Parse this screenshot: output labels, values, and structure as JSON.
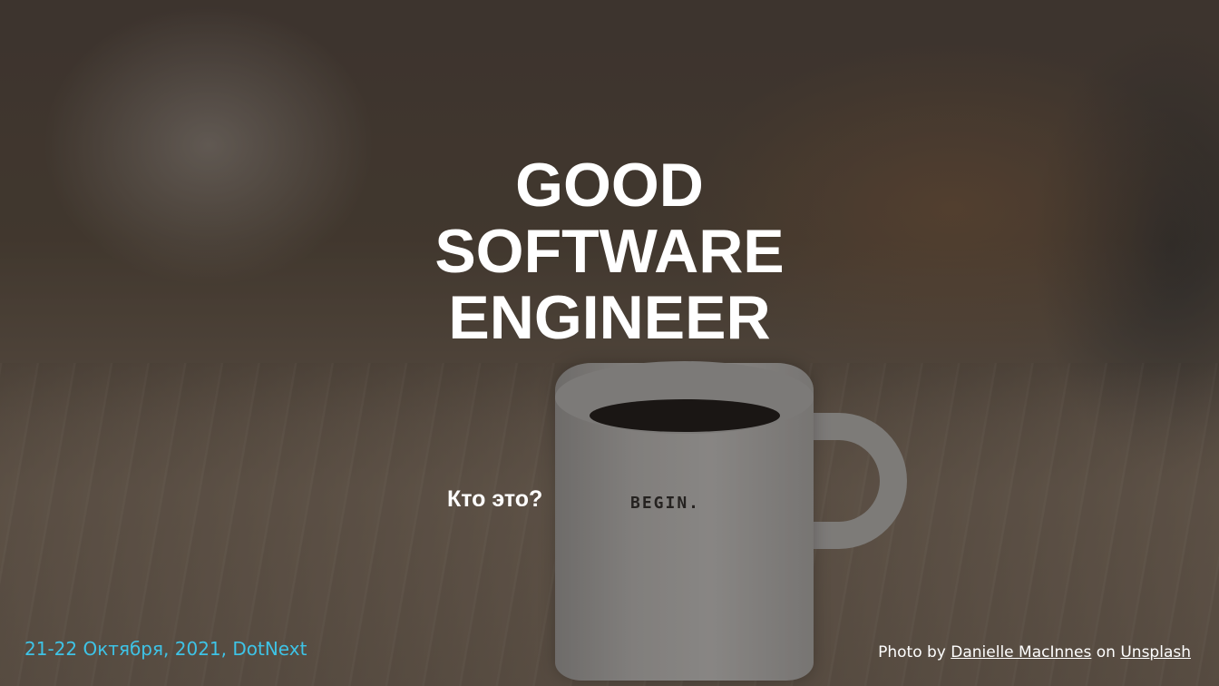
{
  "slide": {
    "title_lines": [
      "GOOD",
      "SOFTWARE",
      "ENGINEER"
    ],
    "subtitle": "Кто это?",
    "mug_text": "BEGIN.",
    "event": "21-22 Октября, 2021, DotNext",
    "credit": {
      "prefix": "Photo by",
      "author": "Danielle MacInnes",
      "middle": "on",
      "source": "Unsplash"
    }
  },
  "colors": {
    "title": "#ffffff",
    "event_text": "#3ec3e6"
  }
}
